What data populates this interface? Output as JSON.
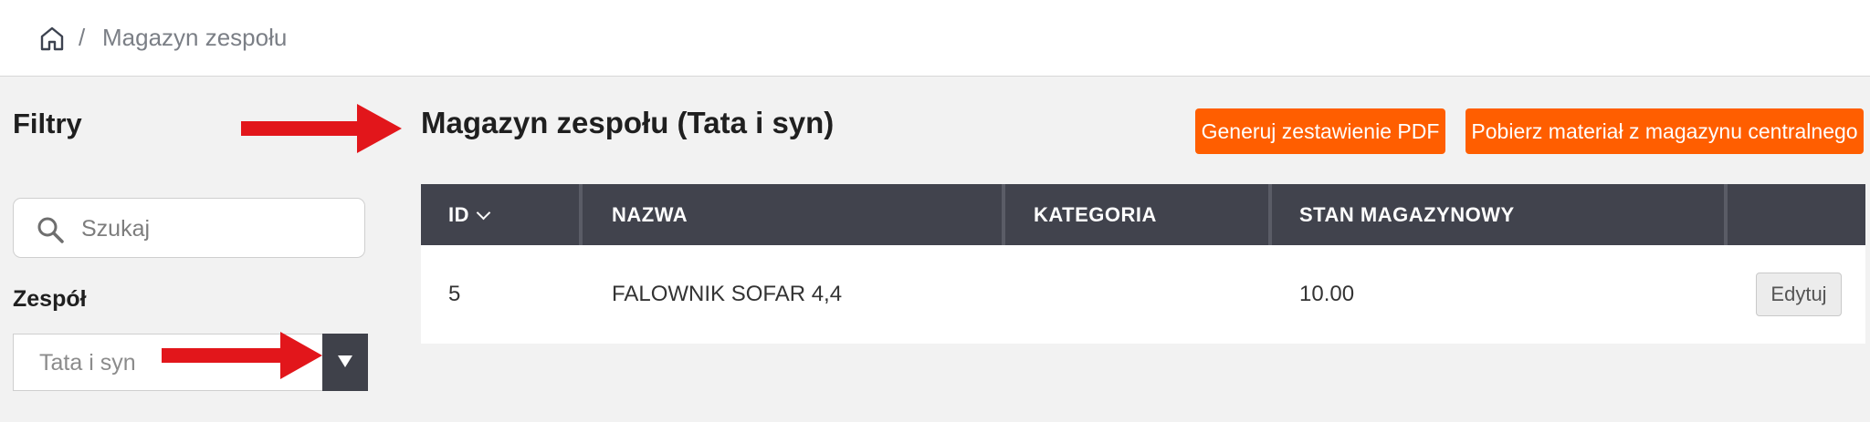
{
  "breadcrumb": {
    "separator": "/",
    "current": "Magazyn zespołu"
  },
  "filters": {
    "title": "Filtry",
    "search_placeholder": "Szukaj",
    "team_label": "Zespół",
    "team_selected": "Tata i syn"
  },
  "main": {
    "title": "Magazyn zespołu (Tata i syn)",
    "buttons": {
      "pdf": "Generuj zestawienie PDF",
      "central": "Pobierz materiał z magazynu centralnego"
    }
  },
  "table": {
    "headers": {
      "id": "ID",
      "name": "NAZWA",
      "category": "KATEGORIA",
      "stock": "STAN MAGAZYNOWY"
    },
    "rows": [
      {
        "id": "5",
        "name": "FALOWNIK SOFAR 4,4",
        "category": "",
        "stock": "10.00",
        "action": "Edytuj"
      }
    ]
  },
  "icons": {
    "home": "home-icon",
    "search": "search-icon",
    "dropdown": "caret-down-icon",
    "sort": "chevron-down-icon",
    "annotation_arrow": "red-arrow-icon"
  },
  "colors": {
    "accent": "#ff5e00",
    "table_header": "#41434d",
    "annotation": "#e2161b"
  }
}
